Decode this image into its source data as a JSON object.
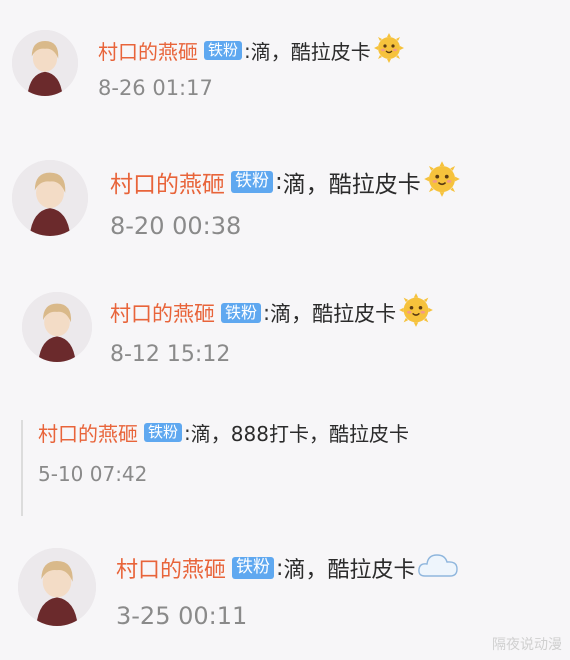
{
  "comments": [
    {
      "username": "村口的燕砸",
      "badge": "铁粉",
      "separator": ":",
      "message": "滴，酷拉皮卡",
      "emoji": "sun-face-emoji",
      "time": "8-26 01:17"
    },
    {
      "username": "村口的燕砸",
      "badge": "铁粉",
      "separator": ":",
      "message": "滴，酷拉皮卡",
      "emoji": "sun-face-emoji",
      "time": "8-20 00:38"
    },
    {
      "username": "村口的燕砸",
      "badge": "铁粉",
      "separator": ":",
      "message": "滴，酷拉皮卡",
      "emoji": "sun-face-emoji",
      "time": "8-12 15:12"
    },
    {
      "username": "村口的燕砸",
      "badge": "铁粉",
      "separator": ":",
      "message": "滴，888打卡，酷拉皮卡",
      "emoji": "",
      "time": "5-10 07:42"
    },
    {
      "username": "村口的燕砸",
      "badge": "铁粉",
      "separator": ":",
      "message": "滴，酷拉皮卡",
      "emoji": "cloud-emoji",
      "time": "3-25 00:11"
    }
  ],
  "watermark": "隔夜说动漫",
  "colors": {
    "username": "#e8643a",
    "badge": "#5fa8f0",
    "time": "#8a8a8a",
    "text": "#2b2b2b"
  }
}
